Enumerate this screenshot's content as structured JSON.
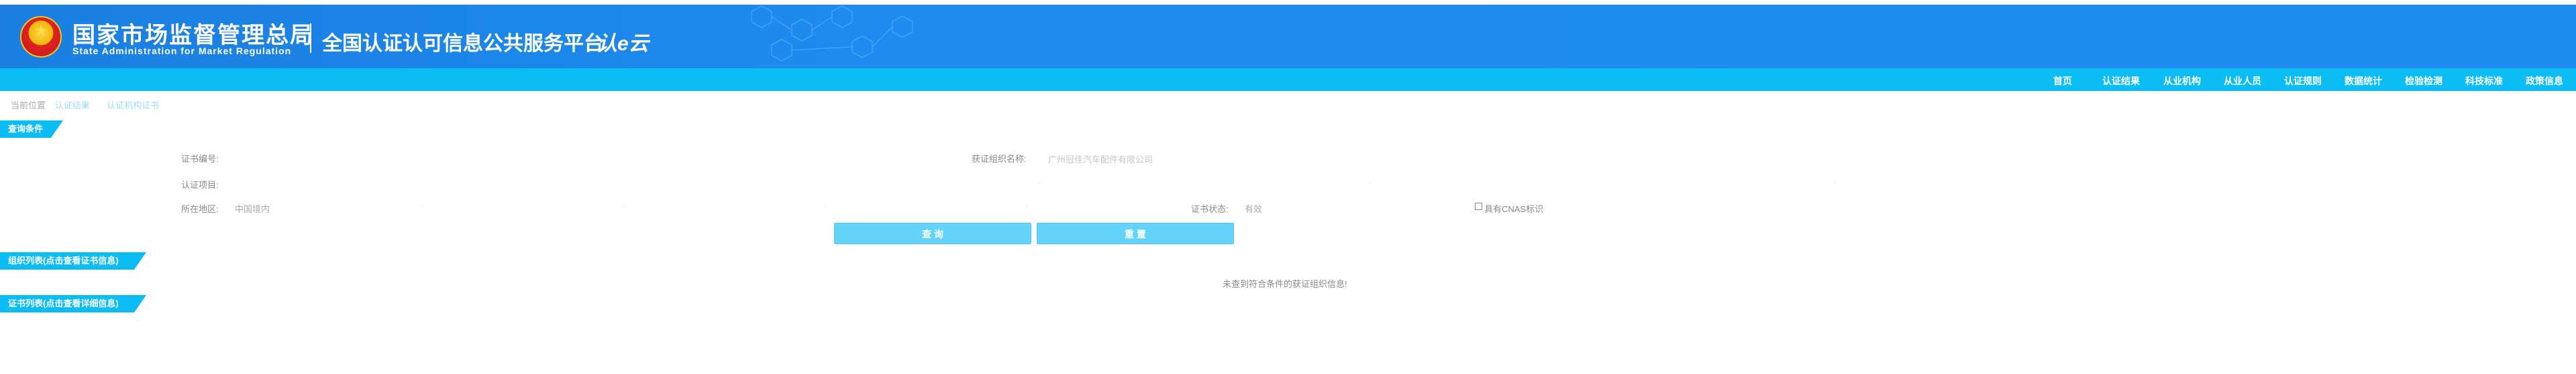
{
  "header": {
    "org_name_cn": "国家市场监督管理总局",
    "org_name_en": "State  Administration  for  Market  Regulation",
    "platform_title": "全国认证认可信息公共服务平台",
    "logo_text": "认e云"
  },
  "nav": {
    "items": [
      "首页",
      "认证结果",
      "从业机构",
      "从业人员",
      "认证规则",
      "数据统计",
      "检验检测",
      "科技标准",
      "政策信息"
    ]
  },
  "breadcrumb": {
    "prefix": "当前位置",
    "items": [
      "认证结果",
      "认证机构证书"
    ]
  },
  "query_section": {
    "title": "查询条件",
    "cert_number_label": "证书编号:",
    "cert_org_label": "获证组织名称:",
    "cert_org_placeholder": "广州冠佳汽车配件有限公司",
    "cert_project_label": "认证项目:",
    "region_label": "所在地区:",
    "region_value": "中国境内",
    "cert_status_label": "证书状态:",
    "cert_status_value": "有效",
    "cnas_label": "具有CNAS标识",
    "search_button": "查 询",
    "reset_button": "重 置"
  },
  "org_list_section": {
    "title": "组织列表(点击查看证书信息)",
    "empty_message": "未查到符合条件的获证组织信息!"
  },
  "cert_list_section": {
    "title": "证书列表(点击查看详细信息)"
  }
}
